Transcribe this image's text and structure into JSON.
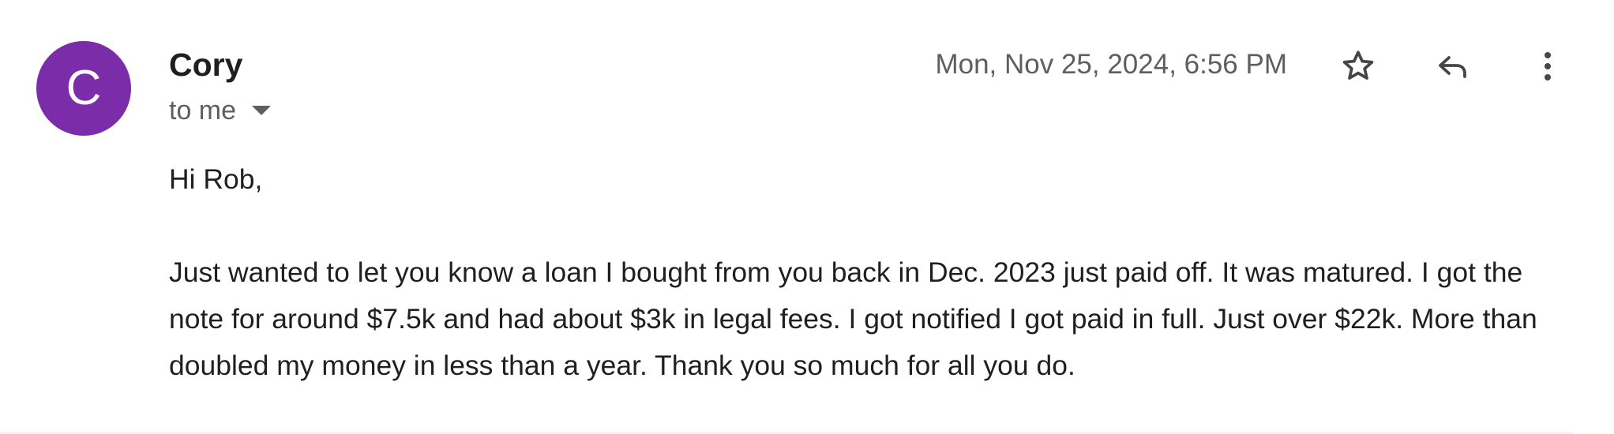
{
  "sender": {
    "avatar_letter": "C",
    "avatar_color": "#7b2ca8",
    "name": "Cory"
  },
  "recipient": {
    "label": "to me",
    "dropdown_icon": "caret-down-icon"
  },
  "timestamp": "Mon, Nov 25, 2024, 6:56 PM",
  "actions": {
    "star_icon": "star-outline-icon",
    "reply_icon": "reply-icon",
    "more_icon": "more-vertical-icon"
  },
  "body": {
    "greeting": "Hi Rob,",
    "paragraph": "Just wanted to let you know a loan I bought from you back in Dec. 2023 just paid off. It was matured. I got the note for around $7.5k and had about $3k in legal fees. I got notified I got paid in full. Just over $22k. More than doubled my money in less than a year. Thank you so much for all you do."
  }
}
